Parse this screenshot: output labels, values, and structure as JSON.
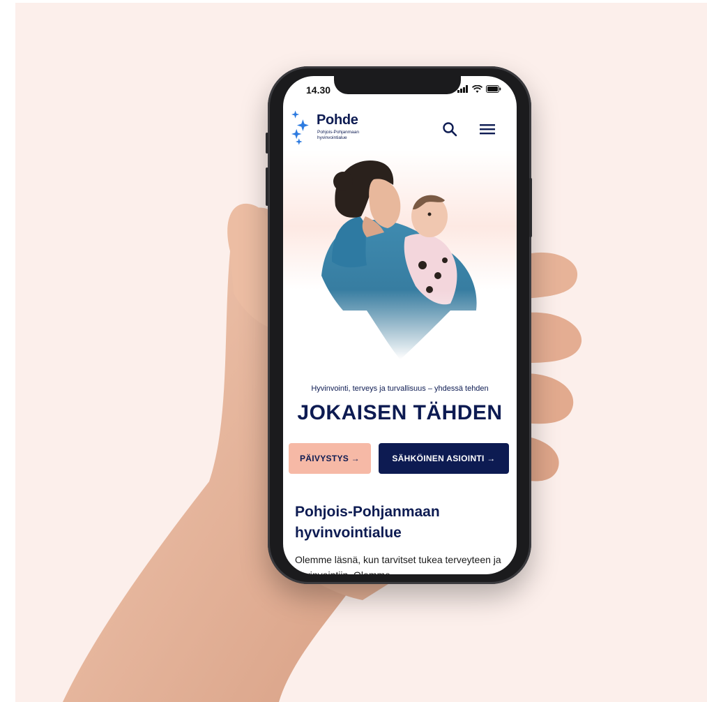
{
  "status_bar": {
    "time": "14.30",
    "signal_icon": "signal-icon",
    "wifi_icon": "wifi-icon",
    "battery_icon": "battery-icon"
  },
  "header": {
    "brand_name": "Pohde",
    "brand_subtitle": "Pohjois-Pohjanmaan hyvinvointialue",
    "search_icon": "search-icon",
    "menu_icon": "hamburger-menu-icon"
  },
  "hero": {
    "tagline": "Hyvinvointi, terveys ja turvallisuus – yhdessä tehden",
    "headline": "JOKAISEN TÄHDEN"
  },
  "actions": {
    "emergency_label": "PÄIVYSTYS →",
    "eservice_label": "SÄHKÖINEN ASIOINTI →"
  },
  "intro": {
    "title": "Pohjois-Pohjanmaan hyvinvointialue",
    "text": "Olemme läsnä, kun tarvitset tukea terveyteen ja hyvinvointiin. Olemme"
  },
  "colors": {
    "brand_navy": "#0d1b52",
    "accent_peach": "#f6b9a6",
    "logo_blue": "#2d7be0",
    "background": "#fcefeb"
  }
}
